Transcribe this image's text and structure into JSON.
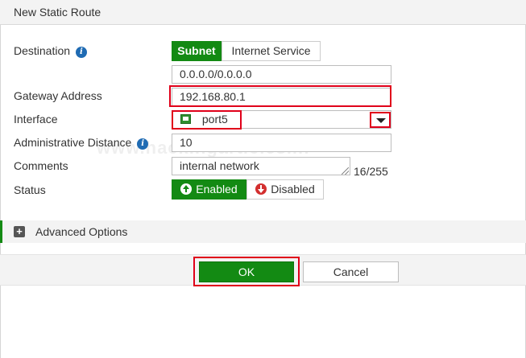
{
  "dialog": {
    "title": "New Static Route"
  },
  "destination": {
    "label": "Destination",
    "info_icon": "info-icon",
    "type_options": [
      "Subnet",
      "Internet Service"
    ],
    "selected_type": "Subnet",
    "value": "0.0.0.0/0.0.0.0"
  },
  "gateway": {
    "label": "Gateway Address",
    "value": "192.168.80.1"
  },
  "interface": {
    "label": "Interface",
    "value": "port5",
    "icon": "network-port-icon",
    "dropdown_icon": "caret-down-icon"
  },
  "admin_distance": {
    "label": "Administrative Distance",
    "info_icon": "info-icon",
    "value": "10"
  },
  "comments": {
    "label": "Comments",
    "value": "internal network",
    "char_count": "16/255"
  },
  "status": {
    "label": "Status",
    "options": [
      {
        "label": "Enabled",
        "icon": "arrow-up-circle-icon"
      },
      {
        "label": "Disabled",
        "icon": "arrow-down-circle-icon"
      }
    ],
    "selected": "Enabled"
  },
  "advanced": {
    "label": "Advanced Options",
    "icon": "plus-square-icon"
  },
  "footer": {
    "ok_label": "OK",
    "cancel_label": "Cancel"
  },
  "watermark": {
    "text": "www.hackingarticles.in"
  },
  "colors": {
    "accent_green": "#138a13",
    "highlight_red": "#e0001a",
    "info_blue": "#1f6bb3"
  }
}
